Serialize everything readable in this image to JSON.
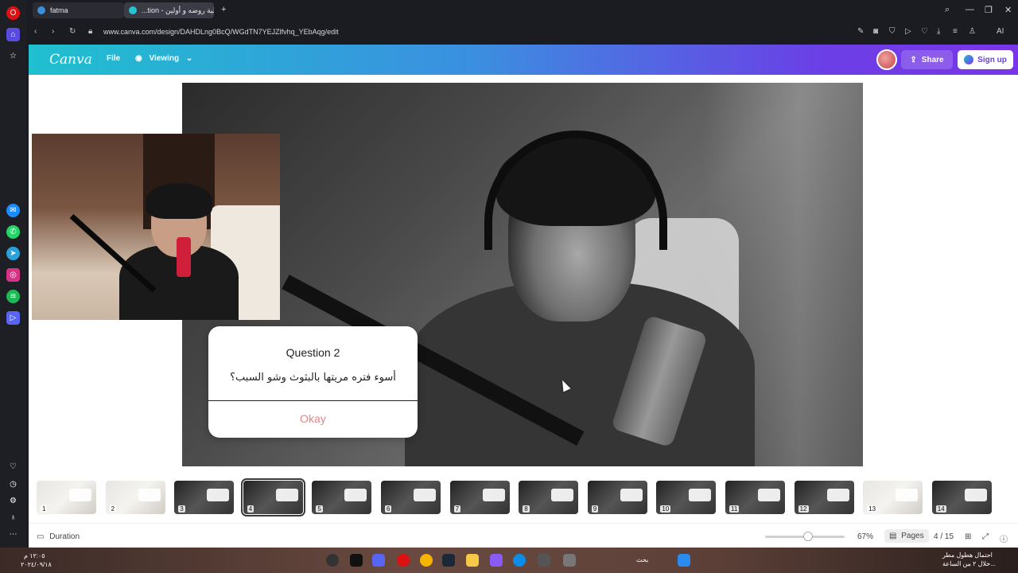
{
  "browser": {
    "tabs": [
      {
        "label": "fatma",
        "color": "#3a8fd6"
      },
      {
        "label": "...tion - فعالية روضه و أولين",
        "color": "#25c3d1"
      }
    ],
    "new_tab_label": "+",
    "url": "www.canva.com/design/DAHDLng0BcQ/WGdTN7YEJZlfvhq_YEbAqg/edit",
    "ai_label": "AI"
  },
  "canva": {
    "logo": "Canva",
    "file_label": "File",
    "viewing_label": "Viewing",
    "share_label": "Share",
    "signup_label": "Sign up"
  },
  "question_card": {
    "title": "Question 2",
    "text": "أسوء فتره مريتها بالبثوث وشو السبب؟",
    "button": "Okay"
  },
  "thumbnails": [
    {
      "num": "1",
      "style": "light"
    },
    {
      "num": "2",
      "style": "light"
    },
    {
      "num": "3",
      "style": "dark"
    },
    {
      "num": "4",
      "style": "dark",
      "active": true
    },
    {
      "num": "5",
      "style": "dark"
    },
    {
      "num": "6",
      "style": "dark"
    },
    {
      "num": "7",
      "style": "dark"
    },
    {
      "num": "8",
      "style": "dark"
    },
    {
      "num": "9",
      "style": "dark"
    },
    {
      "num": "10",
      "style": "dark"
    },
    {
      "num": "11",
      "style": "dark"
    },
    {
      "num": "12",
      "style": "dark"
    },
    {
      "num": "13",
      "style": "light"
    },
    {
      "num": "14",
      "style": "dark"
    }
  ],
  "bottom": {
    "duration_label": "Duration",
    "zoom": "67%",
    "pages_label": "Pages",
    "page_counter": "4 / 15"
  },
  "taskbar": {
    "time": "١٢:٠٥ م",
    "date": "٢٠٢٤/٠٩/١٨",
    "search_label": "بحث",
    "weather_title": "احتمال هطول مطر",
    "weather_sub": "خلال ٢ من الساعة..."
  },
  "colors": {
    "accent_gradient_start": "#1fc0cf",
    "accent_gradient_end": "#7a35e8",
    "okay_color": "#e7828a"
  }
}
